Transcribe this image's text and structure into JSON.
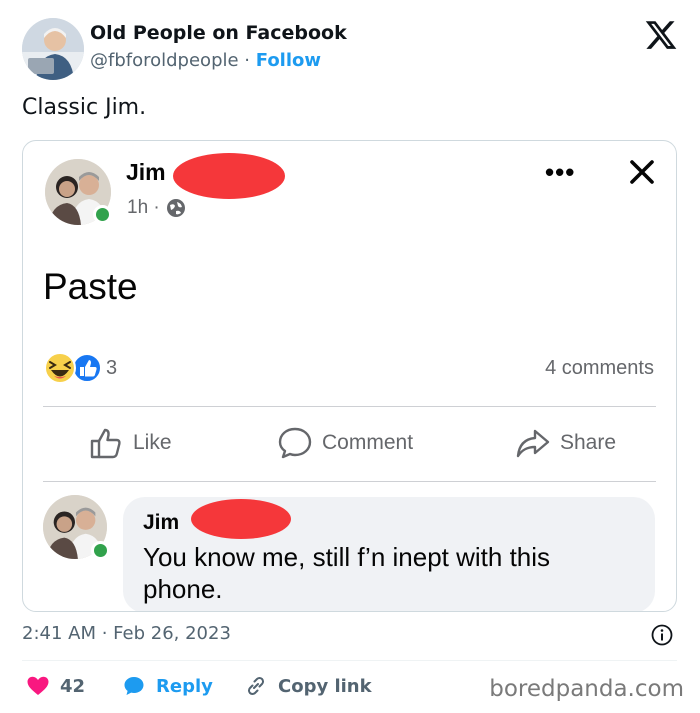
{
  "account": {
    "name": "Old People on Facebook",
    "handle": "@fbforoldpeople",
    "separator": " · ",
    "follow": "Follow"
  },
  "tweet": {
    "text": "Classic Jim.",
    "timestamp": "2:41 AM · Feb 26, 2023"
  },
  "fb_post": {
    "author": "Jim",
    "time": "1h ·",
    "text": "Paste",
    "reaction_count": "3",
    "comments_count": "4 comments",
    "actions": {
      "like": "Like",
      "comment": "Comment",
      "share": "Share"
    },
    "comment": {
      "author": "Jim",
      "text": "You know me, still f’n inept with this phone."
    }
  },
  "footer": {
    "likes": "42",
    "reply": "Reply",
    "copy_link": "Copy link",
    "watermark": "boredpanda.com"
  },
  "icons": {
    "logo": "x-logo-icon",
    "close": "close-icon",
    "more": "more-options-icon",
    "globe": "globe-icon",
    "like": "thumbs-up-icon",
    "comment": "comment-icon",
    "share": "share-icon",
    "heart": "heart-icon",
    "reply": "reply-bubble-icon",
    "link": "link-icon",
    "info": "info-icon"
  },
  "colors": {
    "accent": "#1d9bf0",
    "heart": "#f91880",
    "fb_blue": "#1877f2",
    "online": "#31a24c",
    "redaction": "#f5373a"
  }
}
